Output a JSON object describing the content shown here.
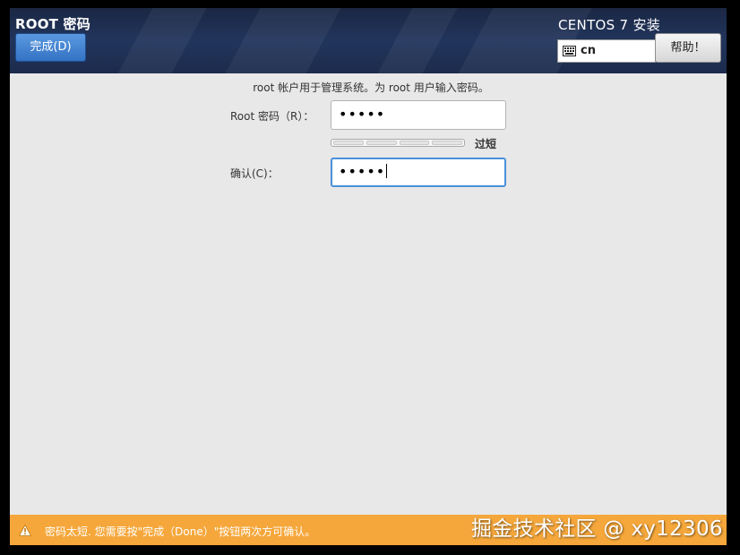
{
  "header": {
    "page_title": "ROOT 密码",
    "done_label": "完成(D)",
    "product_title": "CENTOS 7 安装",
    "keyboard_layout": "cn",
    "help_label": "帮助！"
  },
  "form": {
    "intro": "root 帐户用于管理系统。为 root 用户输入密码。",
    "password_label": "Root 密码（R）：",
    "password_value": "•••••",
    "strength_label": "过短",
    "strength_level": 0,
    "confirm_label": "确认(C)：",
    "confirm_value": "•••••"
  },
  "warning": {
    "text": "密码太短. 您需要按\"完成（Done）\"按钮两次方可确认。"
  },
  "watermark": "掘金技术社区 @ xy12306",
  "colors": {
    "header_bg": "#21355c",
    "done_button": "#3f7fd0",
    "focus_border": "#4a90d9",
    "warning_bar": "#f5a73b"
  },
  "icons": {
    "keyboard": "keyboard-icon",
    "warning": "warning-icon"
  }
}
